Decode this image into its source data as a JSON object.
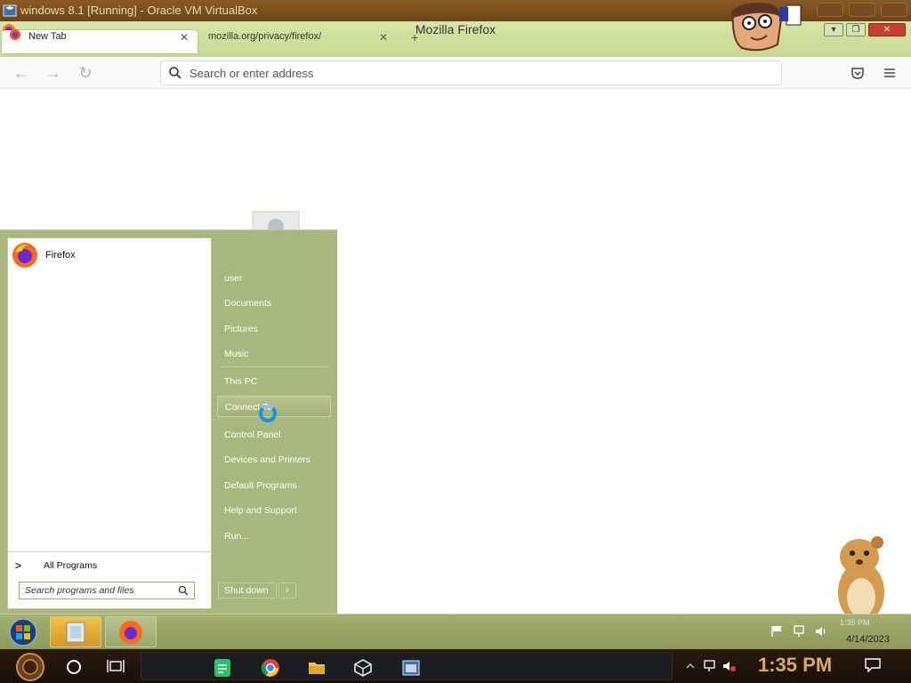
{
  "vbox": {
    "title": "windows 8.1 [Running] - Oracle VM VirtualBox"
  },
  "firefox": {
    "window_title": "Mozilla Firefox",
    "tabs": [
      {
        "label": "New Tab",
        "active": true
      },
      {
        "label": "mozilla.org/privacy/firefox/",
        "active": false
      }
    ],
    "url_placeholder": "Search or enter address"
  },
  "start_menu": {
    "pinned": [
      {
        "label": "Firefox",
        "icon": "firefox-icon"
      }
    ],
    "all_programs": "All Programs",
    "search_placeholder": "Search programs and files",
    "right_items": [
      "user",
      "Documents",
      "Pictures",
      "Music",
      "This PC",
      "Connect To",
      "Control Panel",
      "Devices and Printers",
      "Default Programs",
      "Help and Support",
      "Run..."
    ],
    "hovered_item": "Connect To",
    "shutdown": "Shut down"
  },
  "guest_taskbar": {
    "date": "4/14/2023",
    "time": "1:35 PM"
  },
  "host_taskbar": {
    "time": "1:35 PM"
  },
  "colors": {
    "start_menu_bg": "#a9b67e",
    "vbox_title_bg": "#7a4c1d",
    "host_clock": "#d5ac5e"
  }
}
